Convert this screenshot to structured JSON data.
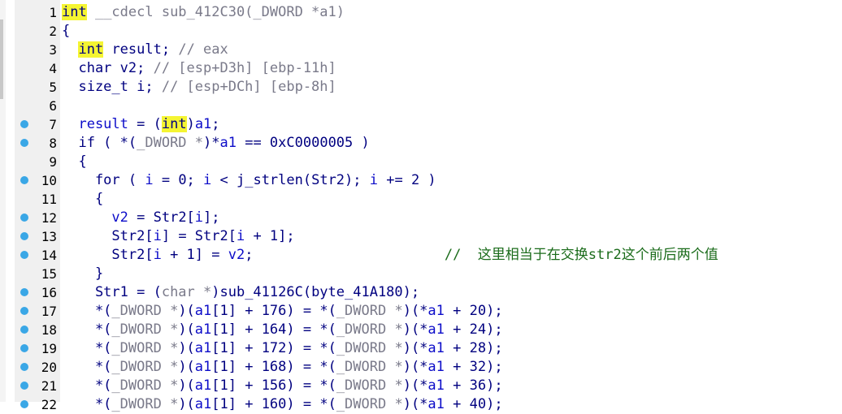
{
  "lines": [
    {
      "n": "1",
      "bp": false,
      "segs": [
        {
          "t": "int",
          "c": "kw hl"
        },
        {
          "t": " __cdecl sub_412C30(_DWORD *a1)",
          "c": "cm"
        }
      ]
    },
    {
      "n": "2",
      "bp": false,
      "segs": [
        {
          "t": "{",
          "c": "pl"
        }
      ]
    },
    {
      "n": "3",
      "bp": false,
      "segs": [
        {
          "t": "  ",
          "c": "pl"
        },
        {
          "t": "int",
          "c": "kw hl"
        },
        {
          "t": " result; ",
          "c": "pl"
        },
        {
          "t": "// eax",
          "c": "cm"
        }
      ]
    },
    {
      "n": "4",
      "bp": false,
      "segs": [
        {
          "t": "  char v2; ",
          "c": "pl"
        },
        {
          "t": "// [esp+D3h] [ebp-11h]",
          "c": "cm"
        }
      ]
    },
    {
      "n": "5",
      "bp": false,
      "segs": [
        {
          "t": "  size_t i; ",
          "c": "pl"
        },
        {
          "t": "// [esp+DCh] [ebp-8h]",
          "c": "cm"
        }
      ]
    },
    {
      "n": "6",
      "bp": false,
      "segs": []
    },
    {
      "n": "7",
      "bp": true,
      "segs": [
        {
          "t": "  result",
          "c": "vr"
        },
        {
          "t": " = (",
          "c": "pl"
        },
        {
          "t": "int",
          "c": "kw hl"
        },
        {
          "t": ")",
          "c": "pl"
        },
        {
          "t": "a1",
          "c": "vr"
        },
        {
          "t": ";",
          "c": "pl"
        }
      ]
    },
    {
      "n": "8",
      "bp": true,
      "segs": [
        {
          "t": "  if ( *(",
          "c": "pl"
        },
        {
          "t": "_DWORD *",
          "c": "cm"
        },
        {
          "t": ")*",
          "c": "pl"
        },
        {
          "t": "a1",
          "c": "vr"
        },
        {
          "t": " == 0xC0000005 )",
          "c": "pl"
        }
      ]
    },
    {
      "n": "9",
      "bp": false,
      "segs": [
        {
          "t": "  {",
          "c": "pl"
        }
      ]
    },
    {
      "n": "10",
      "bp": true,
      "segs": [
        {
          "t": "    for ( ",
          "c": "pl"
        },
        {
          "t": "i",
          "c": "vr"
        },
        {
          "t": " = 0; ",
          "c": "pl"
        },
        {
          "t": "i",
          "c": "vr"
        },
        {
          "t": " < j_strlen(Str2); ",
          "c": "pl"
        },
        {
          "t": "i",
          "c": "vr"
        },
        {
          "t": " += 2 )",
          "c": "pl"
        }
      ]
    },
    {
      "n": "11",
      "bp": false,
      "segs": [
        {
          "t": "    {",
          "c": "pl"
        }
      ]
    },
    {
      "n": "12",
      "bp": true,
      "segs": [
        {
          "t": "      ",
          "c": "pl"
        },
        {
          "t": "v2",
          "c": "vr"
        },
        {
          "t": " = Str2[",
          "c": "pl"
        },
        {
          "t": "i",
          "c": "vr"
        },
        {
          "t": "];",
          "c": "pl"
        }
      ]
    },
    {
      "n": "13",
      "bp": true,
      "segs": [
        {
          "t": "      Str2[",
          "c": "pl"
        },
        {
          "t": "i",
          "c": "vr"
        },
        {
          "t": "] = Str2[",
          "c": "pl"
        },
        {
          "t": "i",
          "c": "vr"
        },
        {
          "t": " + 1];",
          "c": "pl"
        }
      ]
    },
    {
      "n": "14",
      "bp": true,
      "segs": [
        {
          "t": "      Str2[",
          "c": "pl"
        },
        {
          "t": "i",
          "c": "vr"
        },
        {
          "t": " + 1] = ",
          "c": "pl"
        },
        {
          "t": "v2",
          "c": "vr"
        },
        {
          "t": ";                       ",
          "c": "pl"
        },
        {
          "t": "//  这里相当于在交换str2这个前后两个值",
          "c": "cm-cn"
        }
      ]
    },
    {
      "n": "15",
      "bp": false,
      "segs": [
        {
          "t": "    }",
          "c": "pl"
        }
      ]
    },
    {
      "n": "16",
      "bp": true,
      "segs": [
        {
          "t": "    Str1 = (",
          "c": "pl"
        },
        {
          "t": "char *",
          "c": "cm"
        },
        {
          "t": ")sub_41126C(byte_41A180);",
          "c": "pl"
        }
      ]
    },
    {
      "n": "17",
      "bp": true,
      "segs": [
        {
          "t": "    *(",
          "c": "pl"
        },
        {
          "t": "_DWORD *",
          "c": "cm"
        },
        {
          "t": ")(",
          "c": "pl"
        },
        {
          "t": "a1",
          "c": "vr"
        },
        {
          "t": "[1] + 176) = *(",
          "c": "pl"
        },
        {
          "t": "_DWORD *",
          "c": "cm"
        },
        {
          "t": ")(*",
          "c": "pl"
        },
        {
          "t": "a1",
          "c": "vr"
        },
        {
          "t": " + 20);",
          "c": "pl"
        }
      ]
    },
    {
      "n": "18",
      "bp": true,
      "segs": [
        {
          "t": "    *(",
          "c": "pl"
        },
        {
          "t": "_DWORD *",
          "c": "cm"
        },
        {
          "t": ")(",
          "c": "pl"
        },
        {
          "t": "a1",
          "c": "vr"
        },
        {
          "t": "[1] + 164) = *(",
          "c": "pl"
        },
        {
          "t": "_DWORD *",
          "c": "cm"
        },
        {
          "t": ")(*",
          "c": "pl"
        },
        {
          "t": "a1",
          "c": "vr"
        },
        {
          "t": " + 24);",
          "c": "pl"
        }
      ]
    },
    {
      "n": "19",
      "bp": true,
      "segs": [
        {
          "t": "    *(",
          "c": "pl"
        },
        {
          "t": "_DWORD *",
          "c": "cm"
        },
        {
          "t": ")(",
          "c": "pl"
        },
        {
          "t": "a1",
          "c": "vr"
        },
        {
          "t": "[1] + 172) = *(",
          "c": "pl"
        },
        {
          "t": "_DWORD *",
          "c": "cm"
        },
        {
          "t": ")(*",
          "c": "pl"
        },
        {
          "t": "a1",
          "c": "vr"
        },
        {
          "t": " + 28);",
          "c": "pl"
        }
      ]
    },
    {
      "n": "20",
      "bp": true,
      "segs": [
        {
          "t": "    *(",
          "c": "pl"
        },
        {
          "t": "_DWORD *",
          "c": "cm"
        },
        {
          "t": ")(",
          "c": "pl"
        },
        {
          "t": "a1",
          "c": "vr"
        },
        {
          "t": "[1] + 168) = *(",
          "c": "pl"
        },
        {
          "t": "_DWORD *",
          "c": "cm"
        },
        {
          "t": ")(*",
          "c": "pl"
        },
        {
          "t": "a1",
          "c": "vr"
        },
        {
          "t": " + 32);",
          "c": "pl"
        }
      ]
    },
    {
      "n": "21",
      "bp": true,
      "segs": [
        {
          "t": "    *(",
          "c": "pl"
        },
        {
          "t": "_DWORD *",
          "c": "cm"
        },
        {
          "t": ")(",
          "c": "pl"
        },
        {
          "t": "a1",
          "c": "vr"
        },
        {
          "t": "[1] + 156) = *(",
          "c": "pl"
        },
        {
          "t": "_DWORD *",
          "c": "cm"
        },
        {
          "t": ")(*",
          "c": "pl"
        },
        {
          "t": "a1",
          "c": "vr"
        },
        {
          "t": " + 36);",
          "c": "pl"
        }
      ]
    },
    {
      "n": "22",
      "bp": true,
      "segs": [
        {
          "t": "    *(",
          "c": "pl"
        },
        {
          "t": "_DWORD *",
          "c": "cm"
        },
        {
          "t": ")(",
          "c": "pl"
        },
        {
          "t": "a1",
          "c": "vr"
        },
        {
          "t": "[1] + 160) = *(",
          "c": "pl"
        },
        {
          "t": "_DWORD *",
          "c": "cm"
        },
        {
          "t": ")(*",
          "c": "pl"
        },
        {
          "t": "a1",
          "c": "vr"
        },
        {
          "t": " + 40);",
          "c": "pl"
        }
      ]
    }
  ]
}
